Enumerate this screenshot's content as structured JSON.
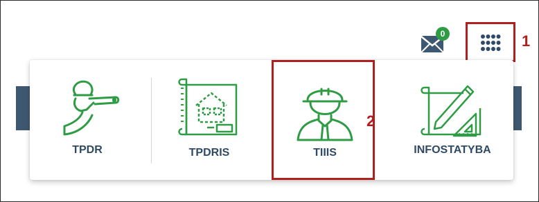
{
  "header": {
    "mail": {
      "icon": "envelope-icon",
      "badge_count": "0"
    },
    "apps_button": {
      "icon": "apps-grid-icon"
    }
  },
  "annotations": {
    "step1": "1",
    "step2": "2"
  },
  "apps_menu": {
    "items": [
      {
        "label": "TPDR",
        "icon": "surveyor-icon"
      },
      {
        "label": "TPDRIS",
        "icon": "blueprint-icon"
      },
      {
        "label": "TIIIS",
        "icon": "construction-worker-icon"
      },
      {
        "label": "INFOSTATYBA",
        "icon": "drafting-icon"
      }
    ]
  },
  "colors": {
    "accent_green": "#2e9c44",
    "label_navy": "#2e4a66",
    "annotation_red": "#b01e1e",
    "sidebar_slate": "#3f5871"
  }
}
